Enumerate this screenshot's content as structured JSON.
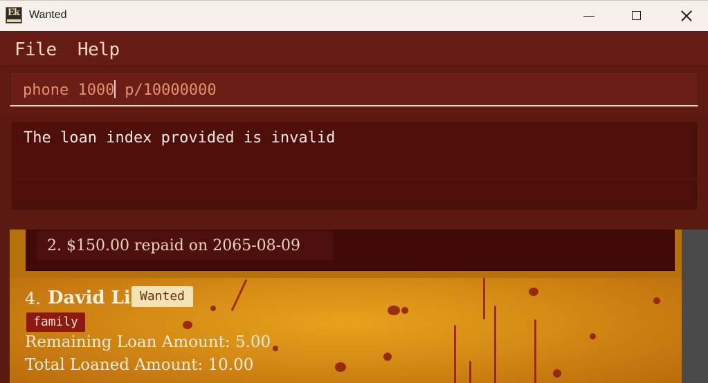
{
  "window": {
    "title": "Wanted"
  },
  "menu": {
    "file_label": "File",
    "help_label": "Help"
  },
  "command": {
    "value": "phone 1000",
    "value_after_caret": " p/10000000"
  },
  "result": {
    "message": "The loan index provided is invalid"
  },
  "list": {
    "previous_repayment": "2. $150.00 repaid on 2065-08-09",
    "person": {
      "index": "4.",
      "name": "David Li",
      "status": "Wanted",
      "tag": "family",
      "remaining_loan": "Remaining Loan Amount: 5.00",
      "total_loaned": "Total Loaned Amount: 10.00"
    }
  },
  "colors": {
    "background": "#5e1a12",
    "card_gold": "#d48a14",
    "blood_red": "#8c1a0e",
    "badge_cream": "#f2e3b4",
    "tag_red": "#8e1812"
  },
  "icons": [
    "app-logo-icon",
    "minimize-icon",
    "maximize-icon",
    "close-icon"
  ]
}
